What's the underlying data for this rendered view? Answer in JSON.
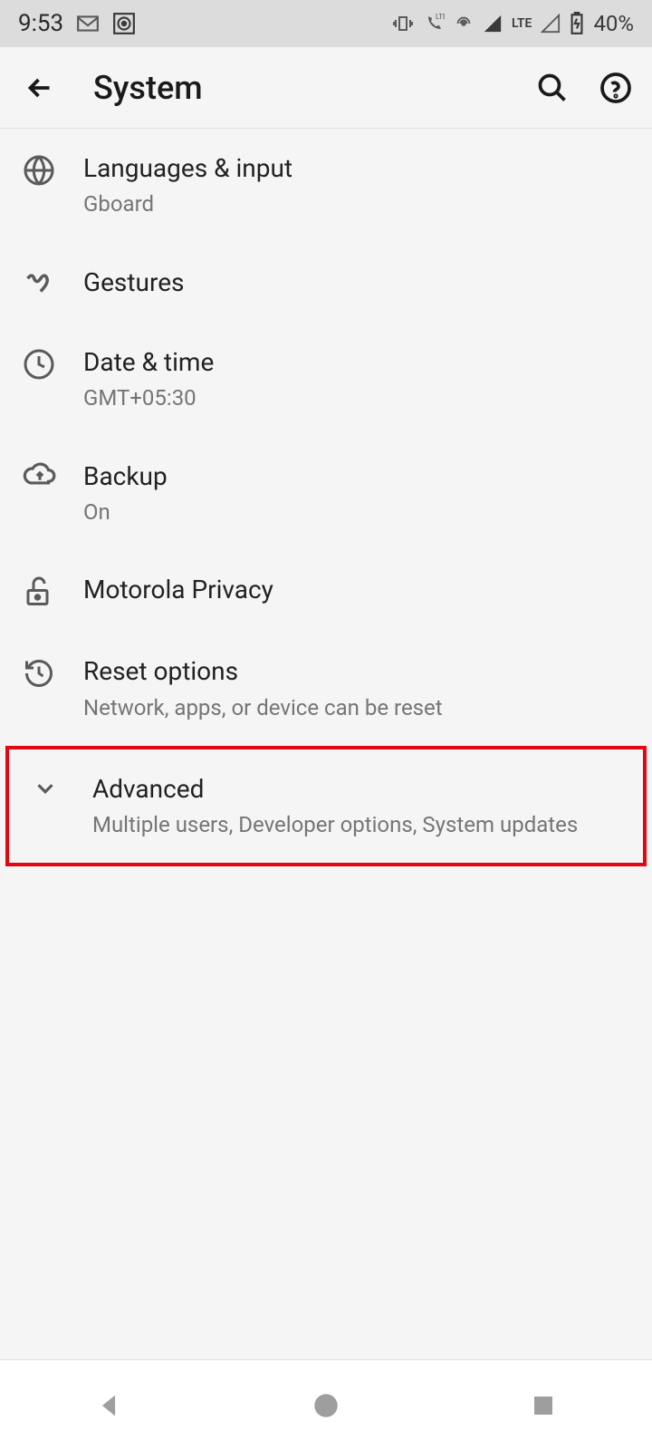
{
  "status_bar": {
    "time": "9:53",
    "battery": "40%",
    "network": "LTE"
  },
  "app_bar": {
    "title": "System"
  },
  "items": [
    {
      "title": "Languages & input",
      "subtitle": "Gboard"
    },
    {
      "title": "Gestures",
      "subtitle": ""
    },
    {
      "title": "Date & time",
      "subtitle": "GMT+05:30"
    },
    {
      "title": "Backup",
      "subtitle": "On"
    },
    {
      "title": "Motorola Privacy",
      "subtitle": ""
    },
    {
      "title": "Reset options",
      "subtitle": "Network, apps, or device can be reset"
    },
    {
      "title": "Advanced",
      "subtitle": "Multiple users, Developer options, System updates"
    }
  ]
}
